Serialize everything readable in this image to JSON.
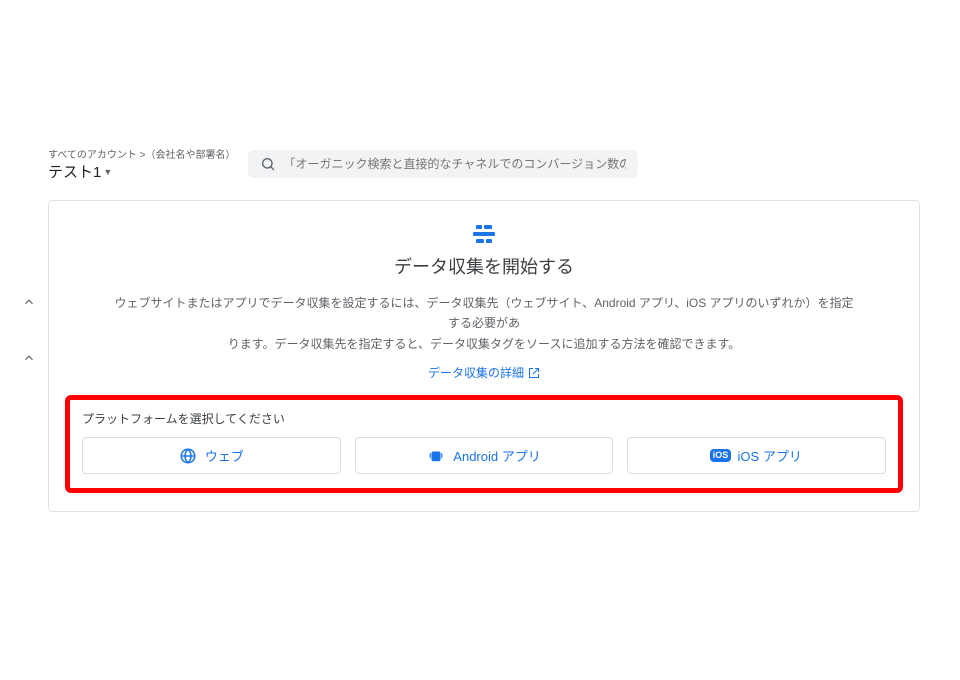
{
  "header": {
    "breadcrumb_top": "すべてのアカウント >（会社名や部署名）",
    "account_name": "テスト1"
  },
  "search": {
    "placeholder": "「オーガニック検索と直接的なチャネルでのコンバージョン数の比較」と検..."
  },
  "panel": {
    "heading": "データ収集を開始する",
    "desc_line1": "ウェブサイトまたはアプリでデータ収集を設定するには、データ収集先（ウェブサイト、Android アプリ、iOS アプリのいずれか）を指定する必要があ",
    "desc_line2": "ります。データ収集先を指定すると、データ収集タグをソースに追加する方法を確認できます。",
    "link_label": "データ収集の詳細"
  },
  "platforms": {
    "label": "プラットフォームを選択してください",
    "options": [
      {
        "label": "ウェブ"
      },
      {
        "label": "Android アプリ"
      },
      {
        "label": "iOS アプリ"
      }
    ]
  }
}
